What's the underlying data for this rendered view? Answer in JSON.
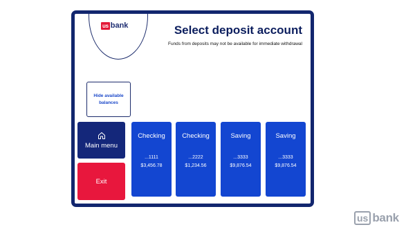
{
  "brand": {
    "us": "us",
    "bank": "bank"
  },
  "header": {
    "title": "Select deposit account",
    "subtitle": "Funds from deposits may not be available for immediate withdrawal"
  },
  "sidebar": {
    "hide_balances": "Hide available balances",
    "main_menu": "Main menu",
    "exit": "Exit"
  },
  "accounts": [
    {
      "type": "Checking",
      "number": "...1111",
      "balance": "$3,456.78"
    },
    {
      "type": "Checking",
      "number": "...2222",
      "balance": "$1,234.56"
    },
    {
      "type": "Saving",
      "number": "...3333",
      "balance": "$9,876.54"
    },
    {
      "type": "Saving",
      "number": "...3333",
      "balance": "$9,876.54"
    }
  ],
  "watermark": {
    "us": "us",
    "bank": "bank"
  },
  "colors": {
    "navy": "#12266e",
    "accent_blue": "#1346d1",
    "exit_red": "#e8173d",
    "brand_red": "#e31837"
  },
  "icons": {
    "main_menu": "home-icon"
  }
}
